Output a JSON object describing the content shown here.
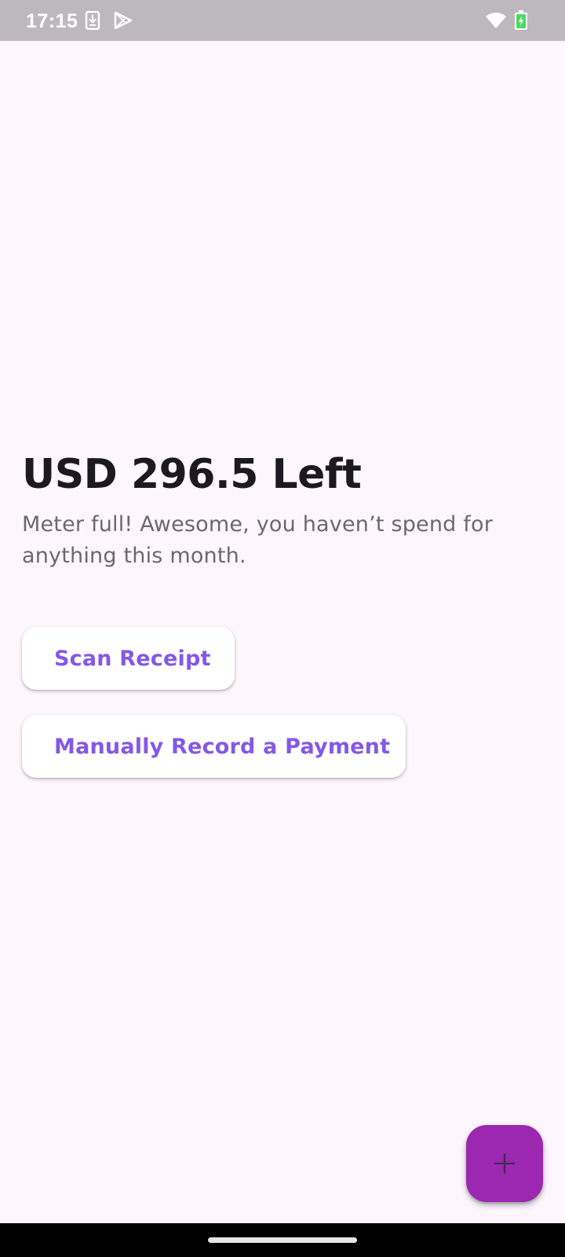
{
  "status_bar": {
    "time": "17:15",
    "icons": [
      "download-icon",
      "play-store-icon",
      "wifi-icon",
      "battery-charging-icon"
    ]
  },
  "main": {
    "balance_title": "USD 296.5 Left",
    "subtitle": "Meter full! Awesome, you haven’t spend for anything this month."
  },
  "actions": {
    "scan_label": "Scan Receipt",
    "manual_label": "Manually Record a Payment"
  },
  "fab": {
    "icon": "plus-icon"
  },
  "colors": {
    "background": "#fdf7fd",
    "status_bar": "#bdb8be",
    "accent_text": "#8458e6",
    "fab": "#9c27b0",
    "battery": "#4cd964"
  }
}
